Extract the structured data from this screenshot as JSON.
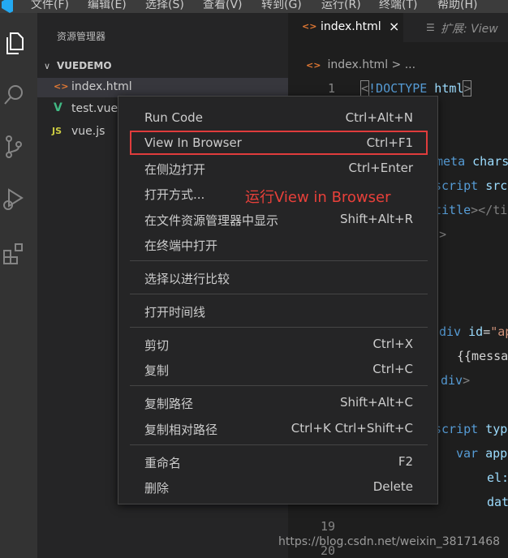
{
  "menu": [
    "文件(F)",
    "编辑(E)",
    "选择(S)",
    "查看(V)",
    "转到(G)",
    "运行(R)",
    "终端(T)",
    "帮助(H)"
  ],
  "activity_icons": [
    "explorer-icon",
    "search-icon",
    "source-control-icon",
    "run-debug-icon",
    "extensions-icon"
  ],
  "sidebar": {
    "title": "资源管理器",
    "folder": "VUEDEMO",
    "files": [
      {
        "name": "index.html",
        "icon": "<>",
        "icon_color": "#e37933"
      },
      {
        "name": "test.vue",
        "icon": "V",
        "icon_color": "#41b883"
      },
      {
        "name": "vue.js",
        "icon": "JS",
        "icon_color": "#cbcb41"
      }
    ]
  },
  "tabs": [
    {
      "label": "index.html",
      "icon": "<>",
      "close": "×"
    },
    {
      "label": "扩展: View",
      "icon": "☰"
    }
  ],
  "breadcrumb": {
    "icon": "<>",
    "text": "index.html > ..."
  },
  "code": {
    "line1_number": "1",
    "line1": [
      "<",
      "!DOCTYPE",
      " html",
      ">"
    ],
    "partial": {
      "meta": "meta",
      "charset": " chars",
      "script1": "script",
      "src": " src",
      "title_open": "title",
      "title_rest": "></ti",
      "close1": ">",
      "div": "div",
      "id": " id",
      "eq": "=",
      "ap": "\"ap",
      "mustache": "{{messa",
      "div_close": "div",
      "script2": "script",
      "typ": " typ",
      "var": "var",
      "app": " app",
      "el": "el:",
      "dat": "dat"
    },
    "line19": "19",
    "line20": "20"
  },
  "context_menu": {
    "groups": [
      [
        {
          "label": "Run Code",
          "shortcut": "Ctrl+Alt+N"
        },
        {
          "label": "View In Browser",
          "shortcut": "Ctrl+F1",
          "highlighted": true
        },
        {
          "label": "在侧边打开",
          "shortcut": "Ctrl+Enter"
        },
        {
          "label": "打开方式...",
          "shortcut": ""
        },
        {
          "label": "在文件资源管理器中显示",
          "shortcut": "Shift+Alt+R"
        },
        {
          "label": "在终端中打开",
          "shortcut": ""
        }
      ],
      [
        {
          "label": "选择以进行比较",
          "shortcut": ""
        }
      ],
      [
        {
          "label": "打开时间线",
          "shortcut": ""
        }
      ],
      [
        {
          "label": "剪切",
          "shortcut": "Ctrl+X"
        },
        {
          "label": "复制",
          "shortcut": "Ctrl+C"
        }
      ],
      [
        {
          "label": "复制路径",
          "shortcut": "Shift+Alt+C"
        },
        {
          "label": "复制相对路径",
          "shortcut": "Ctrl+K Ctrl+Shift+C"
        }
      ],
      [
        {
          "label": "重命名",
          "shortcut": "F2"
        },
        {
          "label": "删除",
          "shortcut": "Delete"
        }
      ]
    ]
  },
  "annotation": "运行View in  Browser",
  "watermark": "https://blog.csdn.net/weixin_38171468",
  "colors": {
    "highlight_border": "#e03c3c",
    "annotation": "#e8403a",
    "vue_green": "#41b883",
    "html_orange": "#e37933",
    "js_yellow": "#cbcb41"
  }
}
